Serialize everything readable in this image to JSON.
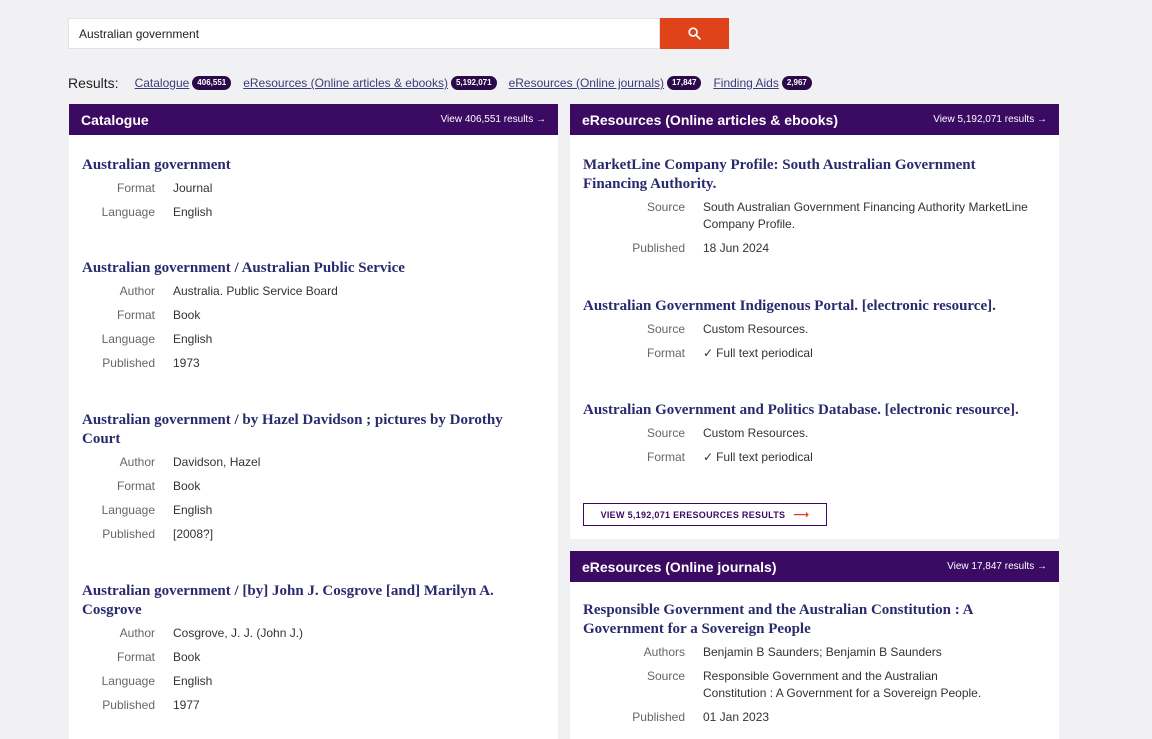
{
  "search": {
    "value": "Australian government"
  },
  "results": {
    "label": "Results:",
    "links": [
      {
        "label": "Catalogue",
        "count": "406,551"
      },
      {
        "label": "eResources (Online articles & ebooks)",
        "count": "5,192,071"
      },
      {
        "label": "eResources (Online journals)",
        "count": "17,847"
      },
      {
        "label": "Finding Aids",
        "count": "2,967"
      }
    ]
  },
  "catalogue": {
    "title": "Catalogue",
    "view_all": "View 406,551 results →",
    "entries": [
      {
        "title": "Australian government",
        "format_label": "Format",
        "format": "Journal",
        "language_label": "Language",
        "language": "English"
      },
      {
        "title": "Australian government / Australian Public Service",
        "author_label": "Author",
        "author": "Australia. Public Service Board",
        "format_label": "Format",
        "format": "Book",
        "language_label": "Language",
        "language": "English",
        "published_label": "Published",
        "published": "1973"
      },
      {
        "title": "Australian government / by Hazel Davidson ; pictures by Dorothy Court",
        "author_label": "Author",
        "author": "Davidson, Hazel",
        "format_label": "Format",
        "format": "Book",
        "language_label": "Language",
        "language": "English",
        "published_label": "Published",
        "published": "[2008?]"
      },
      {
        "title": "Australian government / [by] John J. Cosgrove [and] Marilyn A. Cosgrove",
        "author_label": "Author",
        "author": "Cosgrove, J. J. (John J.)",
        "format_label": "Format",
        "format": "Book",
        "language_label": "Language",
        "language": "English",
        "published_label": "Published",
        "published": "1977"
      }
    ]
  },
  "eresources": {
    "title": "eResources (Online articles & ebooks)",
    "view_all": "View 5,192,071 results →",
    "entries": [
      {
        "title": "MarketLine Company Profile: South Australian Government Financing Authority.",
        "source_label": "Source",
        "source": "South Australian Government Financing Authority MarketLine Company Profile.",
        "published_label": "Published",
        "published": "18 Jun 2024"
      },
      {
        "title": "Australian Government Indigenous Portal. [electronic resource].",
        "source_label": "Source",
        "source": "Custom Resources.",
        "format_label": "Format",
        "format": "Full text periodical"
      },
      {
        "title": "Australian Government and Politics Database. [electronic resource].",
        "source_label": "Source",
        "source": "Custom Resources.",
        "format_label": "Format",
        "format": "Full text periodical"
      }
    ],
    "button_label": "VIEW 5,192,071 ERESOURCES RESULTS"
  },
  "journals": {
    "title": "eResources (Online journals)",
    "view_all": "View 17,847 results →",
    "entries": [
      {
        "title": "Responsible Government and the Australian Constitution : A Government for a Sovereign People",
        "authors_label": "Authors",
        "authors": "Benjamin B Saunders; Benjamin B Saunders",
        "source_label": "Source",
        "source": "Responsible Government and the Australian Constitution : A Government for a Sovereign People.",
        "published_label": "Published",
        "published": "01 Jan 2023"
      }
    ]
  },
  "colors": {
    "header": "#3b0a63",
    "accent": "#e0421a",
    "badge": "#2a0a4a",
    "link": "#2a2a6e"
  },
  "icons": {
    "search": "search-icon",
    "check": "check-icon",
    "arrow": "arrow-right-icon"
  }
}
